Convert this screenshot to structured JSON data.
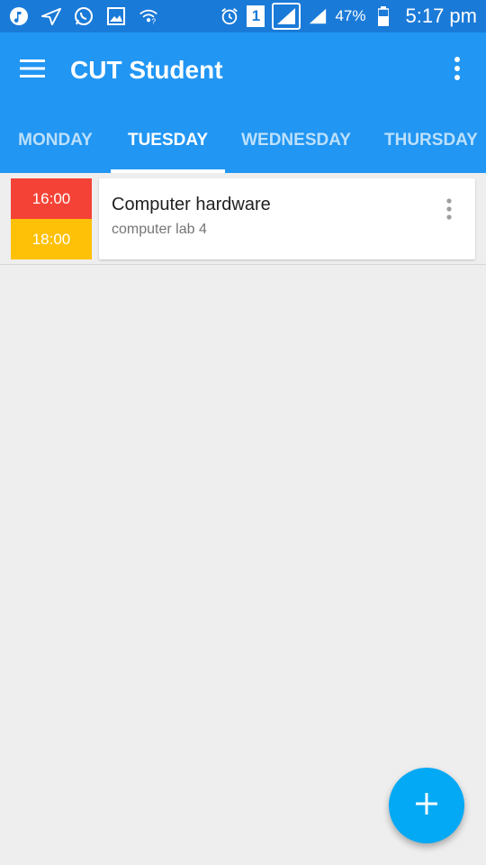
{
  "status_bar": {
    "battery": "47%",
    "time": "5:17 pm",
    "sim": "1",
    "icons": [
      "music-icon",
      "send-icon",
      "whatsapp-icon",
      "image-icon",
      "wifi-icon",
      "alarm-icon",
      "sim-icon",
      "signal-icon",
      "signal-icon",
      "battery-icon"
    ]
  },
  "appbar": {
    "title": "CUT Student",
    "menu_icon": "hamburger-menu-icon",
    "more_icon": "more-vertical-icon"
  },
  "tabs": [
    {
      "label": "MONDAY",
      "active": false
    },
    {
      "label": "TUESDAY",
      "active": true
    },
    {
      "label": "WEDNESDAY",
      "active": false
    },
    {
      "label": "THURSDAY",
      "active": false
    }
  ],
  "entries": [
    {
      "start": "16:00",
      "end": "18:00",
      "subject": "Computer hardware",
      "room": "computer lab 4"
    }
  ],
  "colors": {
    "status_bar": "#1a7ad8",
    "app_bar": "#2196f3",
    "start_time": "#f44336",
    "end_time": "#ffc107",
    "fab": "#03a9f4"
  },
  "fab": {
    "icon": "plus-icon"
  }
}
